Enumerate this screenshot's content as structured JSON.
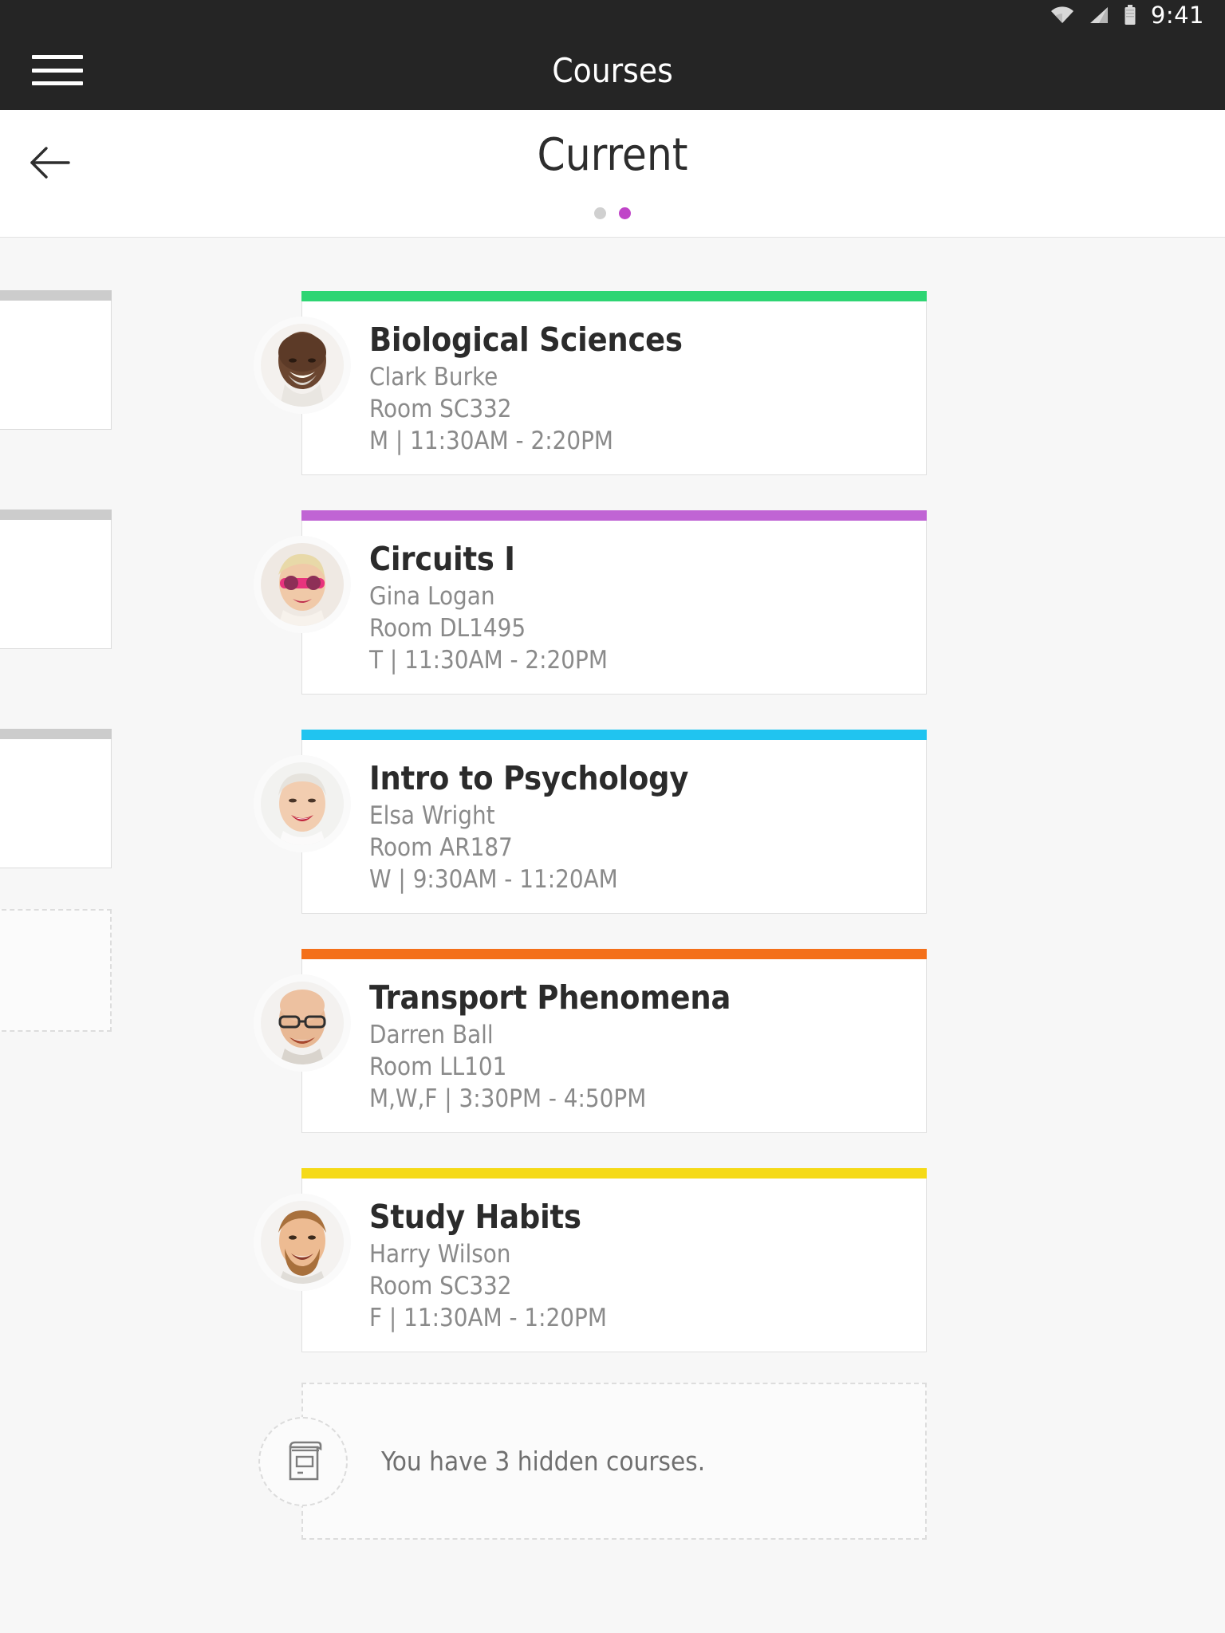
{
  "status_bar": {
    "time": "9:41",
    "icons": [
      "wifi-icon",
      "cellular-signal-icon",
      "battery-icon"
    ]
  },
  "app_bar": {
    "menu_icon": "hamburger-menu-icon",
    "title": "Courses"
  },
  "sub_header": {
    "back_icon": "back-arrow-icon",
    "title": "Current",
    "pager_dots": {
      "count": 2,
      "active_index": 1,
      "active_color": "#c045c8",
      "inactive_color": "#d0d0d0"
    }
  },
  "courses": [
    {
      "name": "Biological Sciences",
      "instructor": "Clark Burke",
      "room": "Room SC332",
      "schedule": "M | 11:30AM - 2:20PM",
      "color": "#2ed573",
      "avatar": "instructor-photo"
    },
    {
      "name": "Circuits I",
      "instructor": "Gina Logan",
      "room": "Room DL1495",
      "schedule": "T | 11:30AM - 2:20PM",
      "color": "#c064d4",
      "avatar": "instructor-photo"
    },
    {
      "name": "Intro to Psychology",
      "instructor": "Elsa Wright",
      "room": "Room AR187",
      "schedule": "W | 9:30AM - 11:20AM",
      "color": "#20c4f0",
      "avatar": "instructor-photo"
    },
    {
      "name": "Transport Phenomena",
      "instructor": "Darren Ball",
      "room": "Room LL101",
      "schedule": "M,W,F | 3:30PM - 4:50PM",
      "color": "#f4701a",
      "avatar": "instructor-photo"
    },
    {
      "name": "Study Habits",
      "instructor": "Harry Wilson",
      "room": "Room SC332",
      "schedule": "F | 11:30AM - 1:20PM",
      "color": "#f5da17",
      "avatar": "instructor-photo"
    }
  ],
  "hidden_courses": {
    "icon": "book-icon",
    "text": "You have 3 hidden courses."
  },
  "theme": {
    "app_bar_bg": "#252525",
    "page_bg": "#f7f7f7",
    "card_bg": "#ffffff",
    "title_text": "#2b2b2b",
    "meta_text": "#8a8a8a"
  }
}
